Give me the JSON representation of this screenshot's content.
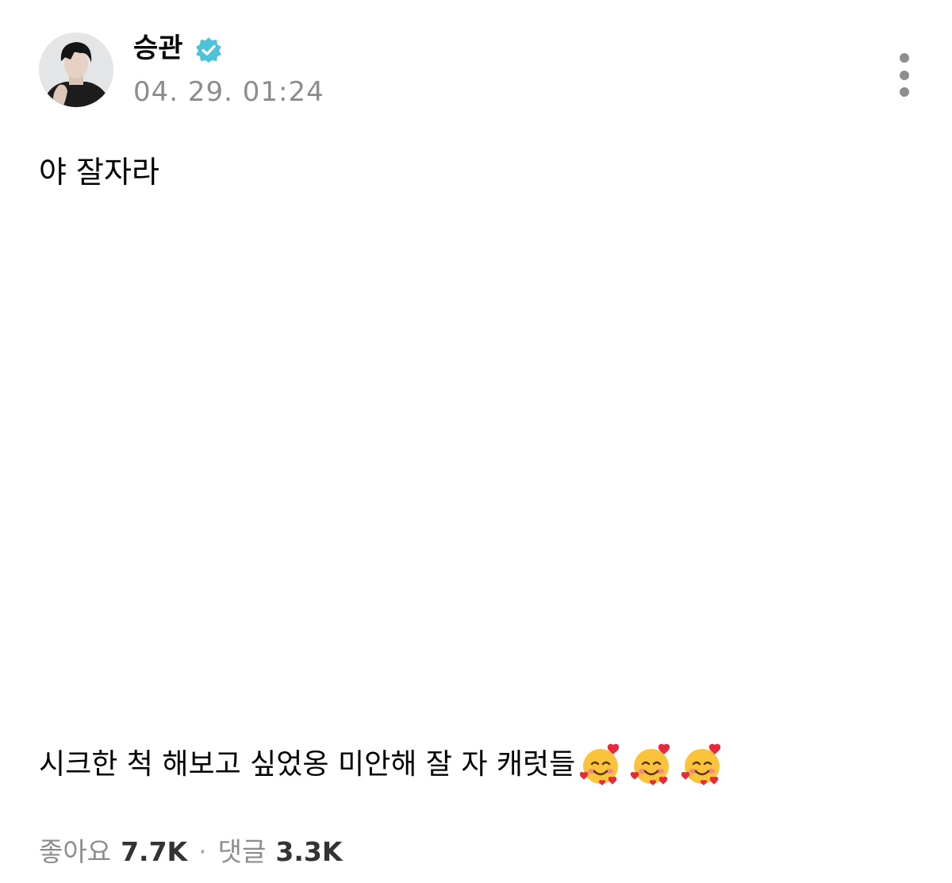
{
  "post": {
    "author": {
      "name": "승관",
      "verified": true,
      "avatar_icon": "profile-photo",
      "verified_icon": "verified-badge-icon",
      "verified_color": "#4cc3d9"
    },
    "timestamp": "04. 29. 01:24",
    "more_icon": "more-vertical-icon",
    "title": "야 잘자라",
    "body_text": "시크한 척 해보고 싶었옹 미안해 잘 자 캐럿들",
    "body_emoji": [
      "smiling-face-with-hearts",
      "smiling-face-with-hearts",
      "smiling-face-with-hearts"
    ],
    "stats": {
      "likes_label": "좋아요",
      "likes_value": "7.7K",
      "separator": "·",
      "comments_label": "댓글",
      "comments_value": "3.3K"
    }
  }
}
